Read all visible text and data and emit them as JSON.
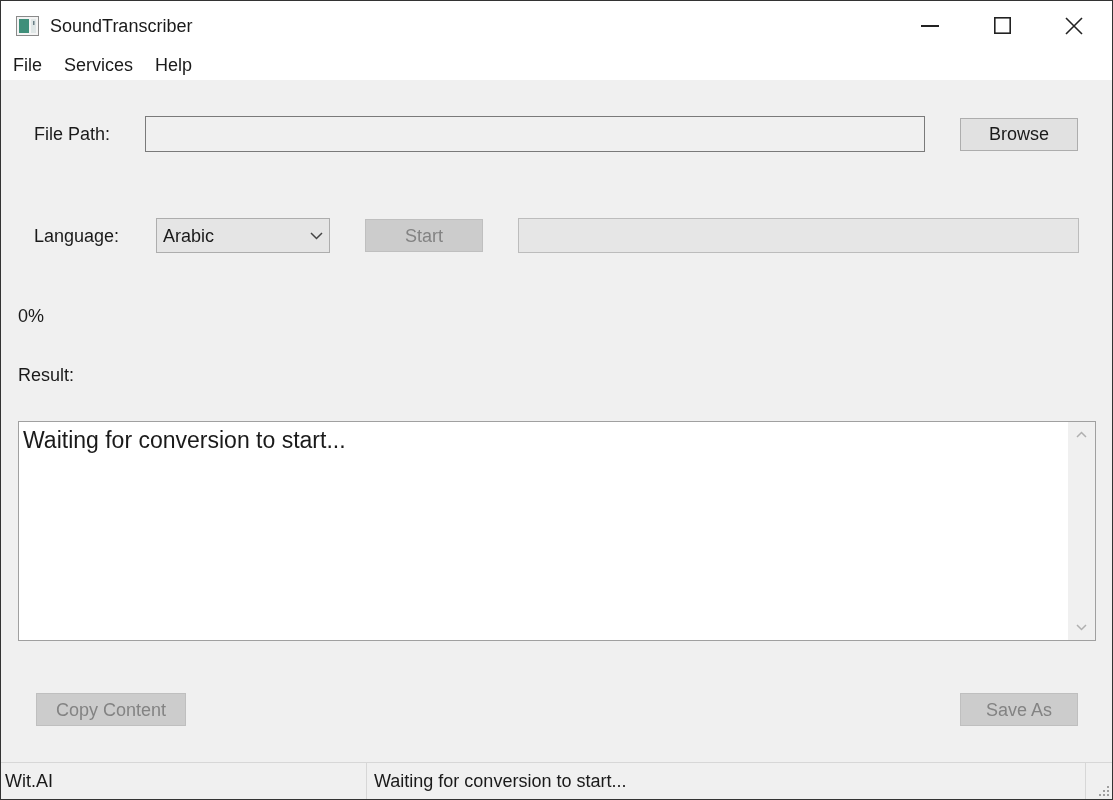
{
  "window": {
    "title": "SoundTranscriber"
  },
  "menu": [
    "File",
    "Services",
    "Help"
  ],
  "file_path": {
    "label": "File Path:"
  },
  "browse_button": {
    "label": "Browse",
    "disabled": false
  },
  "language": {
    "label": "Language:",
    "value": "Arabic"
  },
  "start_button": {
    "label": "Start",
    "disabled": true
  },
  "progress": {
    "level": 0,
    "reading": "0%"
  },
  "result": {
    "label": "Result:",
    "text": "Waiting for conversion to start..."
  },
  "buttons": [
    {
      "label": "Copy Content",
      "disabled": true
    },
    {
      "label": "Save As",
      "disabled": true
    }
  ],
  "status_bar": [
    "Wit.AI",
    "Waiting for conversion to start..."
  ]
}
